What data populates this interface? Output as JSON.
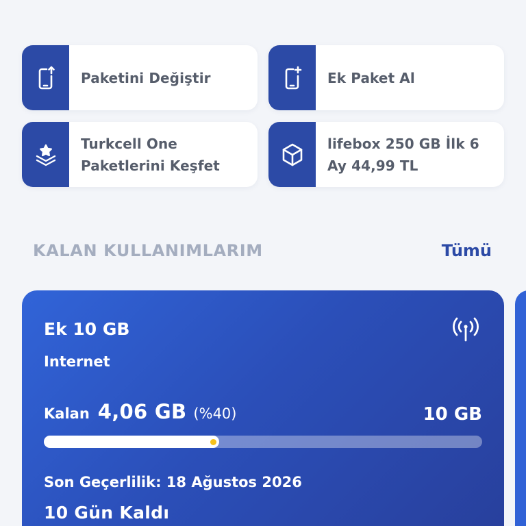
{
  "quick_actions": [
    {
      "icon": "phone-upload-icon",
      "label_lines": [
        "Paketini Değiştir"
      ]
    },
    {
      "icon": "phone-add-icon",
      "label_lines": [
        "Ek Paket Al"
      ]
    },
    {
      "icon": "star-layers-icon",
      "label_lines": [
        "Turkcell One",
        "Paketlerini Keşfet"
      ]
    },
    {
      "icon": "cube-icon",
      "label_lines": [
        "lifebox 250 GB İlk 6",
        "Ay 44,99 TL"
      ]
    }
  ],
  "section": {
    "title": "KALAN KULLANIMLARIM",
    "see_all": "Tümü"
  },
  "usage": {
    "package_name": "Ek 10 GB",
    "type": "Internet",
    "icon": "signal-antenna-icon",
    "remaining_label": "Kalan",
    "remaining_amount": "4,06 GB",
    "remaining_percent_text": "(%40)",
    "total": "10 GB",
    "progress_fraction": 0.4,
    "expiry": "Son Geçerlilik: 18 Ağustos 2026",
    "days_left": "10 Gün Kaldı"
  },
  "colors": {
    "brand_blue": "#2c4aa6",
    "background": "#f3f5f9",
    "progress_marker": "#f7c21b"
  }
}
